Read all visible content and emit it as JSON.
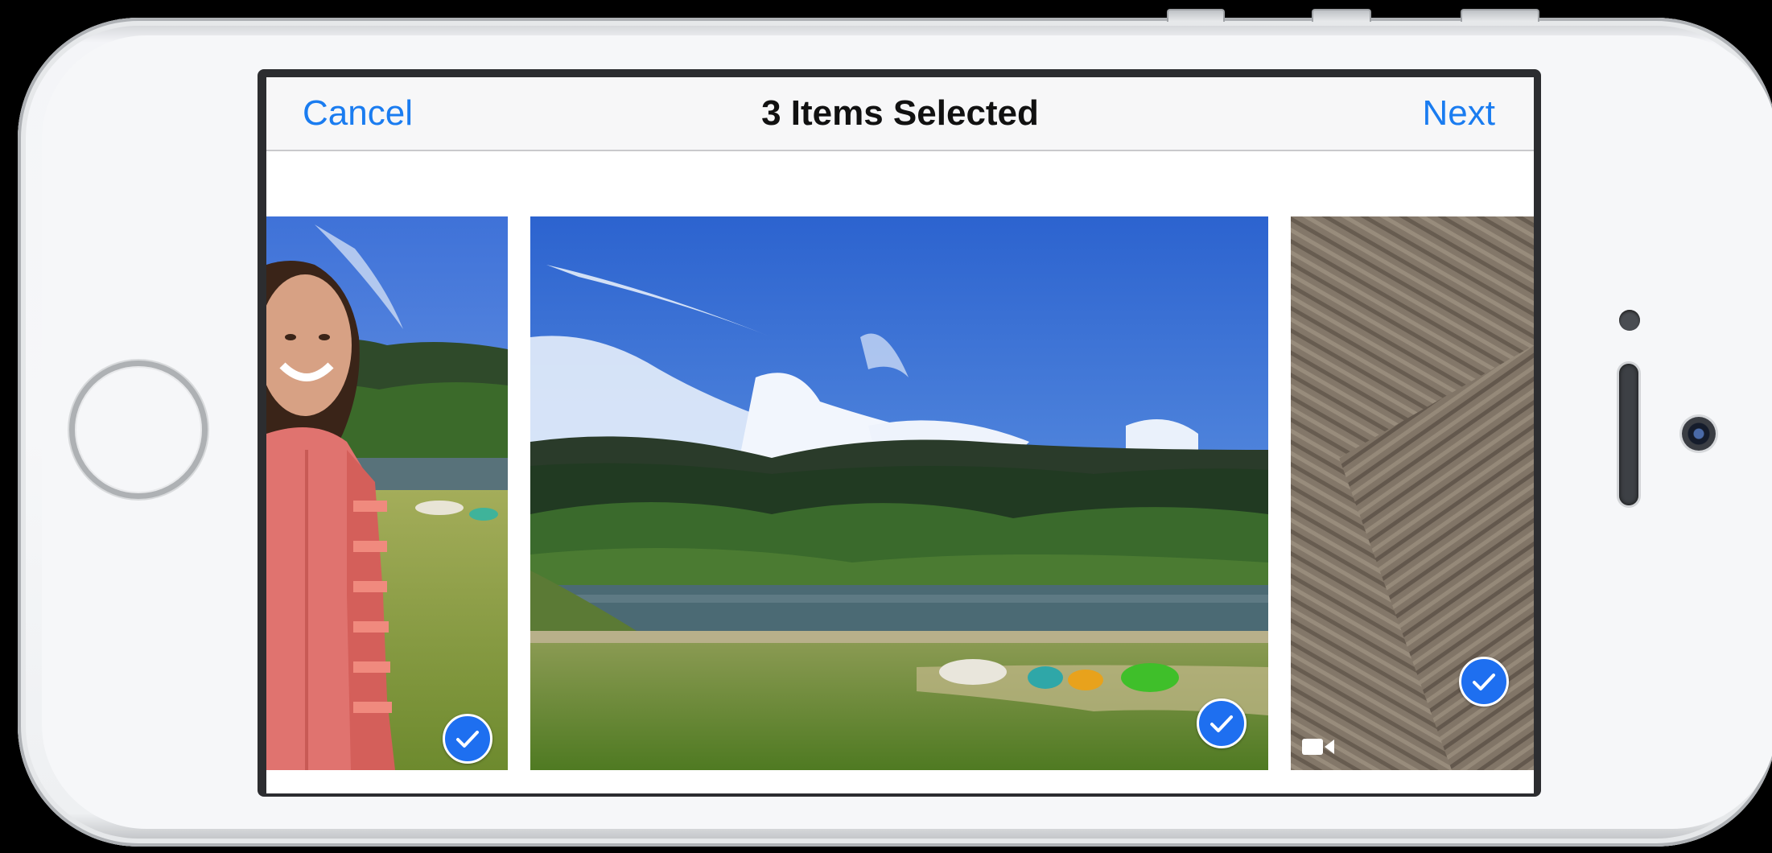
{
  "navbar": {
    "cancel_label": "Cancel",
    "title": "3 Items Selected",
    "next_label": "Next"
  },
  "photos": [
    {
      "subject": "girl in pink hoodie by river",
      "selected": true
    },
    {
      "subject": "river with kayaks and forest",
      "selected": true
    },
    {
      "subject": "carpet texture video",
      "selected": true,
      "is_video": true
    }
  ],
  "icons": {
    "check": "checkmark-circle-icon",
    "video": "video-camera-icon"
  },
  "colors": {
    "accent": "#1a7cf0",
    "check_fill": "#1e6ff0"
  }
}
